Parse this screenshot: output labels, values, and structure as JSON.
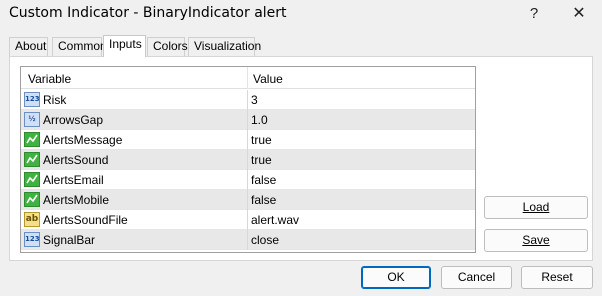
{
  "window": {
    "title": "Custom Indicator - BinaryIndicator alert",
    "help_label": "?",
    "close_label": "✕"
  },
  "tabs": [
    {
      "label": "About"
    },
    {
      "label": "Common"
    },
    {
      "label": "Inputs",
      "active": true
    },
    {
      "label": "Colors"
    },
    {
      "label": "Visualization"
    }
  ],
  "grid": {
    "header": {
      "variable": "Variable",
      "value": "Value"
    },
    "rows": [
      {
        "icon": "integer-icon",
        "icon_text": "123",
        "name": "Risk",
        "value": "3"
      },
      {
        "icon": "double-icon",
        "icon_text": "½",
        "name": "ArrowsGap",
        "value": "1.0"
      },
      {
        "icon": "bool-icon",
        "icon_text": "",
        "name": "AlertsMessage",
        "value": "true"
      },
      {
        "icon": "bool-icon",
        "icon_text": "",
        "name": "AlertsSound",
        "value": "true"
      },
      {
        "icon": "bool-icon",
        "icon_text": "",
        "name": "AlertsEmail",
        "value": "false"
      },
      {
        "icon": "bool-icon",
        "icon_text": "",
        "name": "AlertsMobile",
        "value": "false"
      },
      {
        "icon": "string-icon",
        "icon_text": "ab",
        "name": "AlertsSoundFile",
        "value": "alert.wav"
      },
      {
        "icon": "integer-icon",
        "icon_text": "123",
        "name": "SignalBar",
        "value": "close"
      }
    ]
  },
  "side_buttons": {
    "load_label": "Load",
    "save_label": "Save"
  },
  "footer": {
    "ok_label": "OK",
    "cancel_label": "Cancel",
    "reset_label": "Reset"
  }
}
